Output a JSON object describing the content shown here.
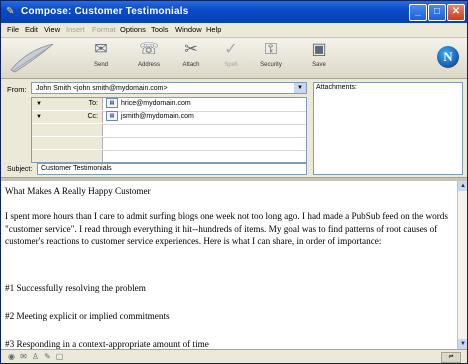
{
  "window": {
    "title": "Compose: Customer Testimonials"
  },
  "menu": [
    {
      "label": "File",
      "enabled": true
    },
    {
      "label": "Edit",
      "enabled": true
    },
    {
      "label": "View",
      "enabled": true
    },
    {
      "label": "Insert",
      "enabled": false
    },
    {
      "label": "Format",
      "enabled": false
    },
    {
      "label": "Options",
      "enabled": true
    },
    {
      "label": "Tools",
      "enabled": true
    },
    {
      "label": "Window",
      "enabled": true
    },
    {
      "label": "Help",
      "enabled": true
    }
  ],
  "toolbar": {
    "send": {
      "label": "Send",
      "icon": "send-icon"
    },
    "address": {
      "label": "Address",
      "icon": "address-icon"
    },
    "attach": {
      "label": "Attach",
      "icon": "attach-icon"
    },
    "spell": {
      "label": "Spell",
      "icon": "spell-icon"
    },
    "security": {
      "label": "Security",
      "icon": "security-icon"
    },
    "save": {
      "label": "Save",
      "icon": "save-icon"
    }
  },
  "header": {
    "from_label": "From:",
    "from_value": "John Smith <john smith@mydomain.com>",
    "to_type": "To:",
    "to_value": "hrice@mydomain.com",
    "cc_type": "Cc:",
    "cc_value": "jsmith@mydomain.com",
    "subject_label": "Subject:",
    "subject_value": "Customer Testimonials",
    "attachments_label": "Attachments:"
  },
  "body": {
    "heading": "What Makes A Really Happy Customer",
    "para1": "I spent more hours than I care to admit surfing blogs one week not too long ago. I had made a PubSub feed on the words \"customer service\". I read through everything it hit--hundreds of items. My goal was to find patterns of root causes of customer's reactions to customer service experiences. Here is what I can share, in order of importance:",
    "item1": "#1 Successfully resolving the problem",
    "item2": "#2 Meeting explicit or implied commitments",
    "item3": "#3 Responding in a context-appropriate amount of time"
  },
  "colors": {
    "titlebar": "#0a4bc8",
    "accent": "#7f9db9"
  }
}
